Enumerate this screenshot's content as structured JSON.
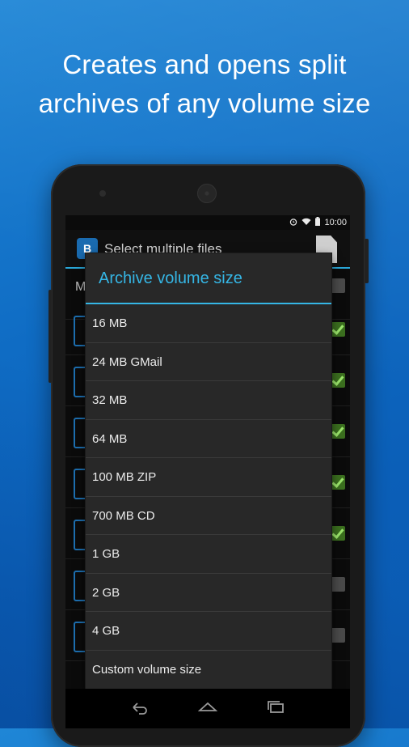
{
  "headline": {
    "line1": "Creates and opens split",
    "line2": "archives of any volume size"
  },
  "statusbar": {
    "time": "10:00",
    "icons": [
      "alarm-icon",
      "wifi-icon",
      "battery-icon"
    ]
  },
  "actionbar": {
    "app_icon_letter": "B",
    "title": "Select multiple files",
    "zip_icon": "zip-file-icon"
  },
  "background_list": {
    "partial_letter": "M",
    "checkbox_states": [
      false,
      true,
      true,
      true,
      true,
      true,
      false,
      false
    ]
  },
  "dialog": {
    "title": "Archive volume size",
    "options": [
      "16 MB",
      "24 MB GMail",
      "32 MB",
      "64 MB",
      "100 MB ZIP",
      "700 MB CD",
      "1 GB",
      "2 GB",
      "4 GB",
      "Custom volume size"
    ]
  },
  "navbar": {
    "buttons": [
      "back-icon",
      "home-icon",
      "recent-apps-icon"
    ]
  },
  "colors": {
    "accent": "#35b6e5",
    "background_blue": "#0f6cc4",
    "dialog_bg": "#282828"
  }
}
